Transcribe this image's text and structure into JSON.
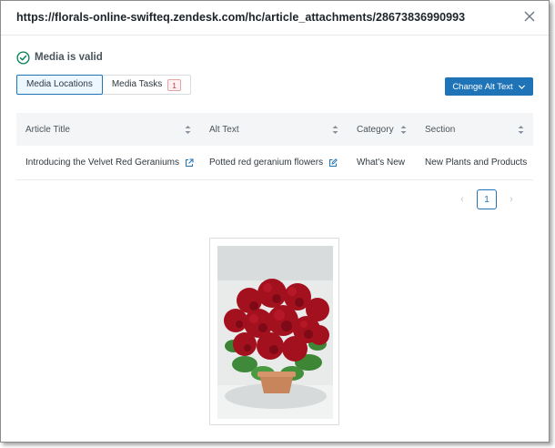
{
  "header": {
    "title": "https://florals-online-swifteq.zendesk.com/hc/article_attachments/28673836990993"
  },
  "status": {
    "text": "Media is valid",
    "color": "#038153"
  },
  "tabs": [
    {
      "label": "Media Locations",
      "active": true
    },
    {
      "label": "Media Tasks",
      "badge": "1"
    }
  ],
  "actions": {
    "change_alt_text": "Change Alt Text"
  },
  "table": {
    "columns": [
      "Article Title",
      "Alt Text",
      "Category",
      "Section"
    ],
    "rows": [
      {
        "article_title": "Introducing the Velvet Red Geraniums",
        "alt_text": "Potted red geranium flowers",
        "category": "What's New",
        "section": "New Plants and Products"
      }
    ]
  },
  "pagination": {
    "current": "1",
    "prev": "‹",
    "next": "›"
  },
  "colors": {
    "accent": "#1f73b7",
    "success": "#038153",
    "badge_red": "#cc3340"
  },
  "icons": [
    "close-icon",
    "check-circle-icon",
    "chevron-down-icon",
    "sort-icon",
    "external-link-icon"
  ]
}
